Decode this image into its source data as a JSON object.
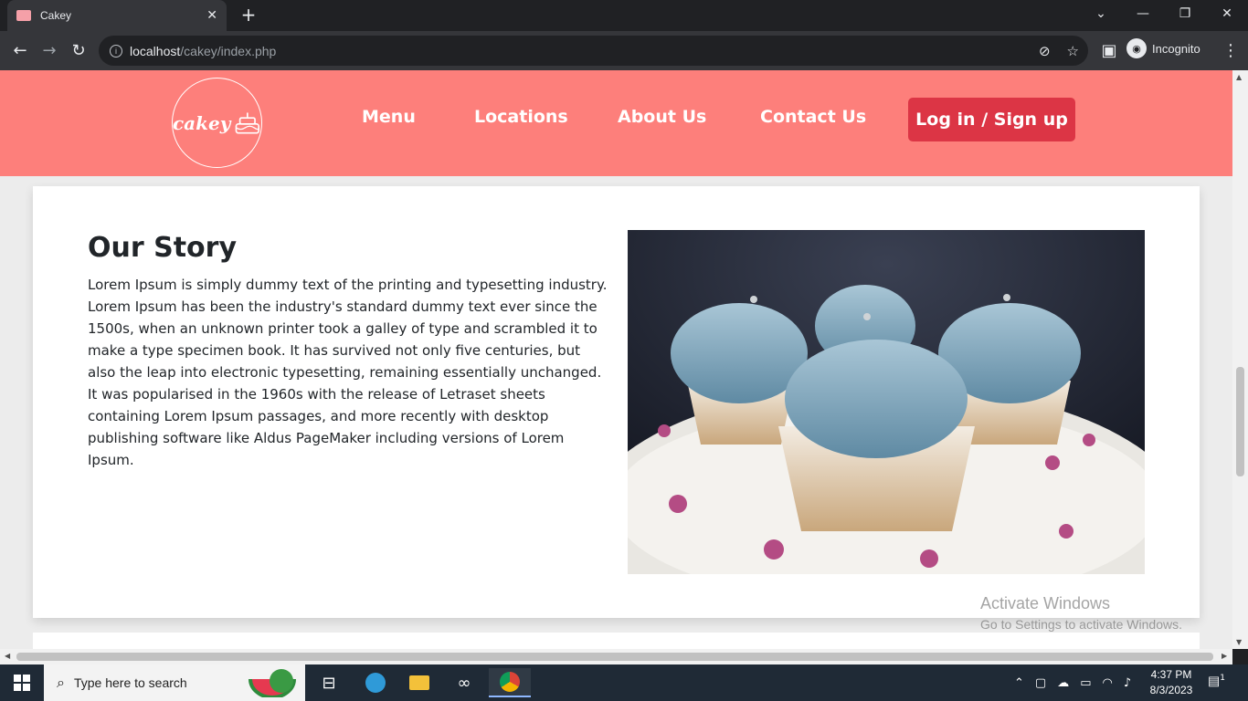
{
  "browser": {
    "tab_title": "Cakey",
    "url_host": "localhost",
    "url_path": "/cakey/index.php",
    "profile_label": "Incognito"
  },
  "site": {
    "logo_text": "cakey",
    "nav": [
      "Menu",
      "Locations",
      "About Us",
      "Contact Us"
    ],
    "login_label": "Log in / Sign up",
    "colors": {
      "header": "#fd7f7b",
      "login": "#dc3545"
    }
  },
  "story": {
    "title": "Our Story",
    "body": "Lorem Ipsum is simply dummy text of the printing and typesetting industry. Lorem Ipsum has been the industry's standard dummy text ever since the 1500s, when an unknown printer took a galley of type and scrambled it to make a type specimen book. It has survived not only five centuries, but also the leap into electronic typesetting, remaining essentially unchanged. It was popularised in the 1960s with the release of Letraset sheets containing Lorem Ipsum passages, and more recently with desktop publishing software like Aldus PageMaker including versions of Lorem Ipsum.",
    "image": "blue-frosted-cupcakes-photo"
  },
  "watermark": {
    "line1": "Activate Windows",
    "line2": "Go to Settings to activate Windows."
  },
  "taskbar": {
    "search_placeholder": "Type here to search",
    "time": "4:37 PM",
    "date": "8/3/2023",
    "notification_count": "1"
  }
}
